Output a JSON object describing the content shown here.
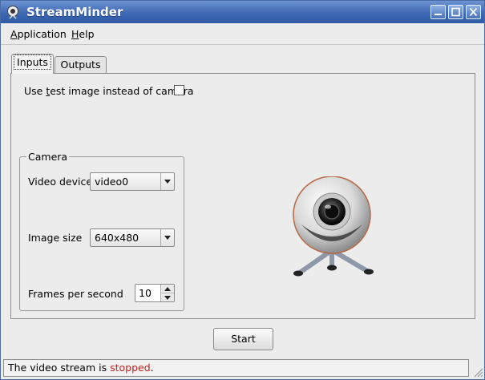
{
  "window": {
    "title": "StreamMinder"
  },
  "menu": {
    "application": "Application",
    "application_rest": "pplication",
    "application_key": "A",
    "help": "Help",
    "help_rest": "elp",
    "help_key": "H"
  },
  "tabs": [
    {
      "label": "Inputs",
      "selected": true
    },
    {
      "label": "Outputs",
      "selected": false
    }
  ],
  "inputs": {
    "test_image_label_pre": "Use ",
    "test_image_label_key": "t",
    "test_image_label_post": "est image instead of camera",
    "test_image_checked": false,
    "camera_group_title": "Camera",
    "video_device_label": "Video device",
    "video_device_value": "video0",
    "image_size_label": "Image size",
    "image_size_value": "640x480",
    "fps_label": "Frames per second",
    "fps_value": "10"
  },
  "actions": {
    "start_label": "Start"
  },
  "status": {
    "prefix": "The video stream is ",
    "state": "stopped",
    "suffix": "."
  },
  "colors": {
    "titlebar": "#3e68b2",
    "status_stopped": "#c8221c"
  },
  "icons": {
    "app": "webcam-icon",
    "minimize": "minimize-icon",
    "maximize": "maximize-icon",
    "close": "close-icon"
  }
}
